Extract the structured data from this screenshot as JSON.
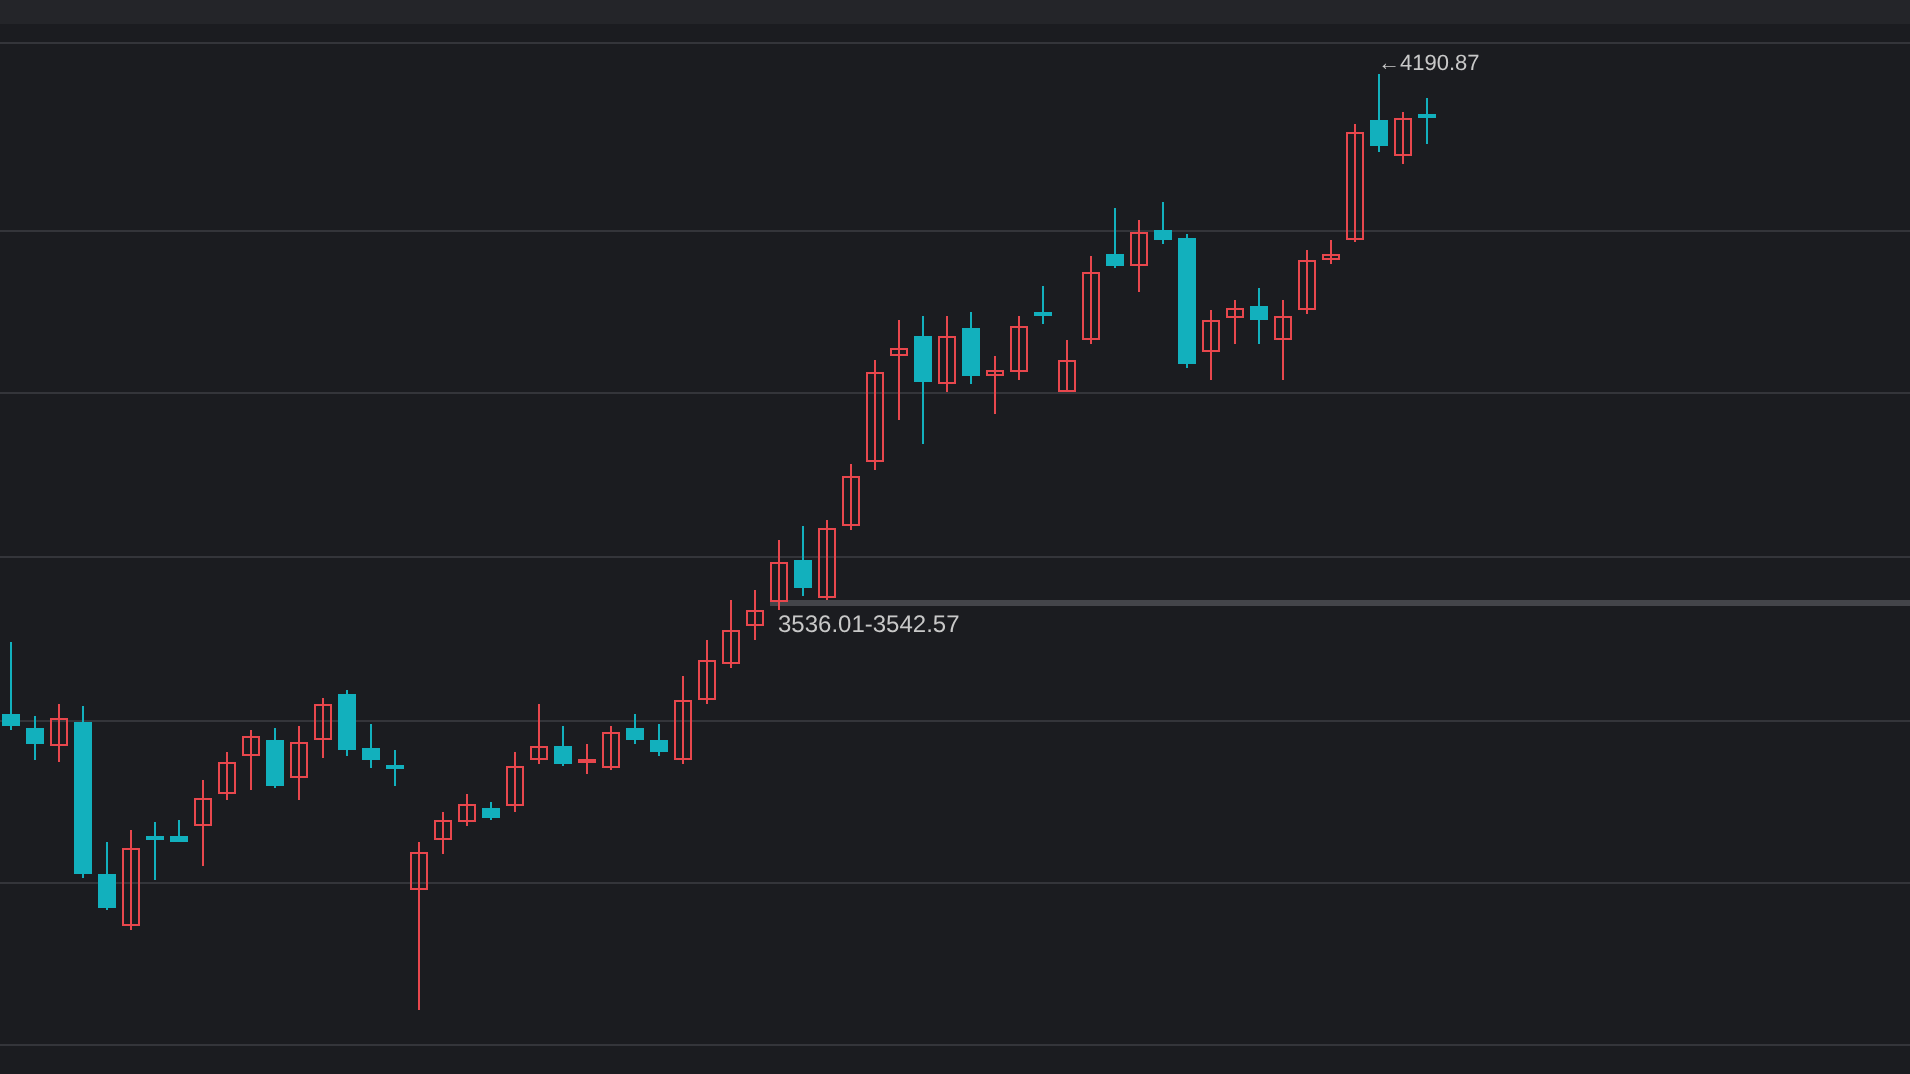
{
  "chart": {
    "high_label": "←4190.87",
    "gap_label": "3536.01-3542.57"
  }
}
